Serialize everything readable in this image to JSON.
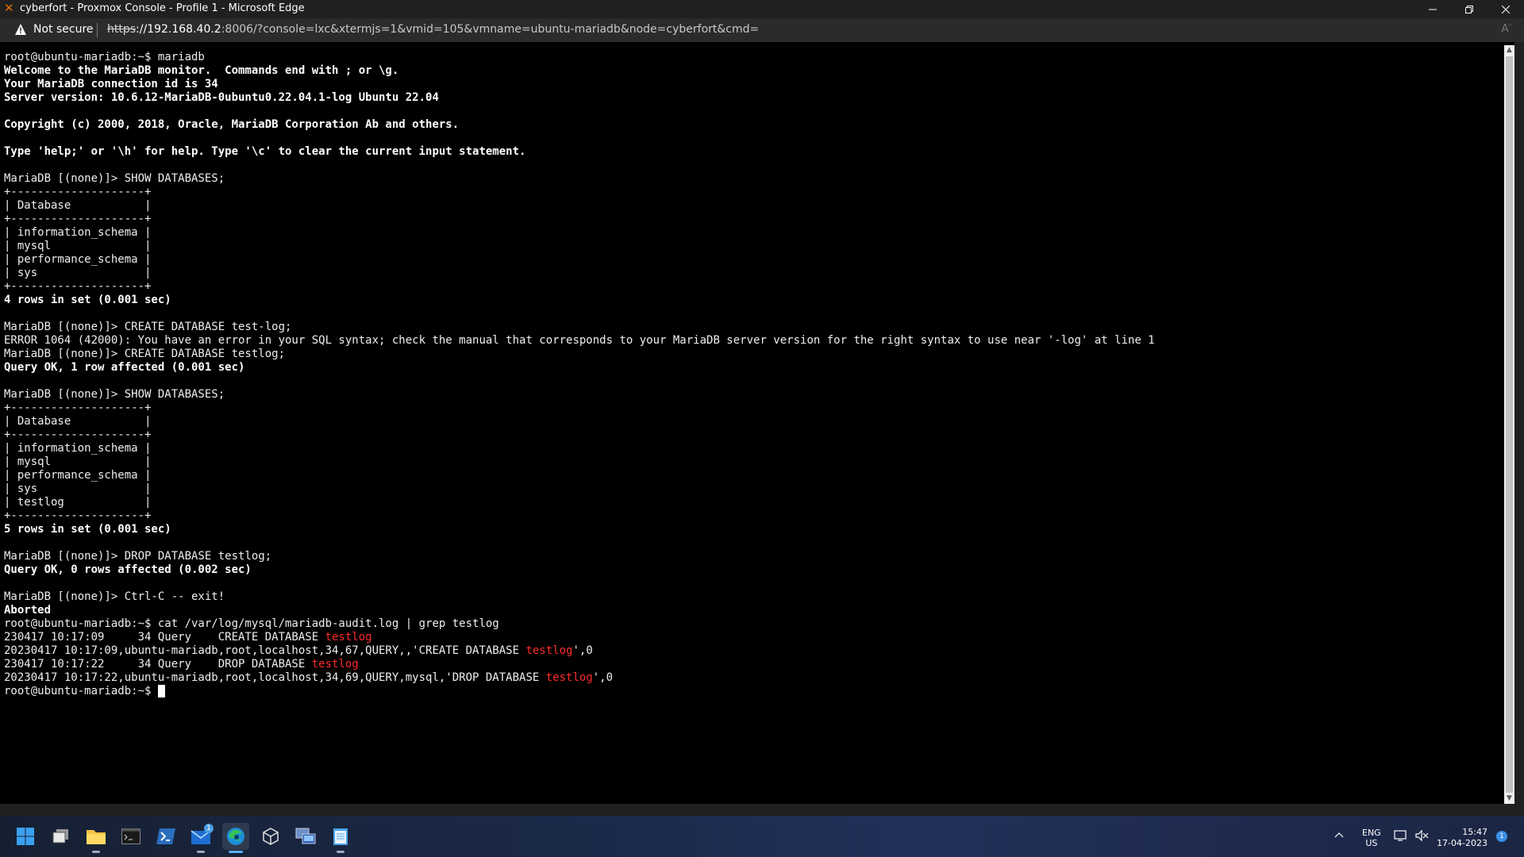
{
  "window": {
    "title": "cyberfort - Proxmox Console - Profile 1 - Microsoft Edge"
  },
  "addressbar": {
    "security_label": "Not secure",
    "url_scheme": "https",
    "url_host": "://192.168.40.2",
    "url_rest": ":8006/?console=lxc&xtermjs=1&vmid=105&vmname=ubuntu-mariadb&node=cyberfort&cmd="
  },
  "terminal": {
    "lines": [
      [
        {
          "t": "root@ubuntu-mariadb:~$ mariadb"
        }
      ],
      [
        {
          "t": "Welcome to the MariaDB monitor.  Commands end with ; or \\g.",
          "s": "b"
        }
      ],
      [
        {
          "t": "Your MariaDB connection id is 34",
          "s": "b"
        }
      ],
      [
        {
          "t": "Server version: 10.6.12-MariaDB-0ubuntu0.22.04.1-log Ubuntu 22.04",
          "s": "b"
        }
      ],
      [
        {
          "t": ""
        }
      ],
      [
        {
          "t": "Copyright (c) 2000, 2018, Oracle, MariaDB Corporation Ab and others.",
          "s": "b"
        }
      ],
      [
        {
          "t": ""
        }
      ],
      [
        {
          "t": "Type 'help;' or '\\h' for help. Type '\\c' to clear the current input statement.",
          "s": "b"
        }
      ],
      [
        {
          "t": ""
        }
      ],
      [
        {
          "t": "MariaDB [(none)]> SHOW DATABASES;"
        }
      ],
      [
        {
          "t": "+--------------------+"
        }
      ],
      [
        {
          "t": "| Database           |"
        }
      ],
      [
        {
          "t": "+--------------------+"
        }
      ],
      [
        {
          "t": "| information_schema |"
        }
      ],
      [
        {
          "t": "| mysql              |"
        }
      ],
      [
        {
          "t": "| performance_schema |"
        }
      ],
      [
        {
          "t": "| sys                |"
        }
      ],
      [
        {
          "t": "+--------------------+"
        }
      ],
      [
        {
          "t": "4 rows in set (0.001 sec)",
          "s": "b"
        }
      ],
      [
        {
          "t": ""
        }
      ],
      [
        {
          "t": "MariaDB [(none)]> CREATE DATABASE test-log;"
        }
      ],
      [
        {
          "t": "ERROR 1064 (42000): You have an error in your SQL syntax; check the manual that corresponds to your MariaDB server version for the right syntax to use near '-log' at line 1"
        }
      ],
      [
        {
          "t": "MariaDB [(none)]> CREATE DATABASE testlog;"
        }
      ],
      [
        {
          "t": "Query OK, 1 row affected (0.001 sec)",
          "s": "b"
        }
      ],
      [
        {
          "t": ""
        }
      ],
      [
        {
          "t": "MariaDB [(none)]> SHOW DATABASES;"
        }
      ],
      [
        {
          "t": "+--------------------+"
        }
      ],
      [
        {
          "t": "| Database           |"
        }
      ],
      [
        {
          "t": "+--------------------+"
        }
      ],
      [
        {
          "t": "| information_schema |"
        }
      ],
      [
        {
          "t": "| mysql              |"
        }
      ],
      [
        {
          "t": "| performance_schema |"
        }
      ],
      [
        {
          "t": "| sys                |"
        }
      ],
      [
        {
          "t": "| testlog            |"
        }
      ],
      [
        {
          "t": "+--------------------+"
        }
      ],
      [
        {
          "t": "5 rows in set (0.001 sec)",
          "s": "b"
        }
      ],
      [
        {
          "t": ""
        }
      ],
      [
        {
          "t": "MariaDB [(none)]> DROP DATABASE testlog;"
        }
      ],
      [
        {
          "t": "Query OK, 0 rows affected (0.002 sec)",
          "s": "b"
        }
      ],
      [
        {
          "t": ""
        }
      ],
      [
        {
          "t": "MariaDB [(none)]> Ctrl-C -- exit!"
        }
      ],
      [
        {
          "t": "Aborted",
          "s": "b"
        }
      ],
      [
        {
          "t": "root@ubuntu-mariadb:~$ cat /var/log/mysql/mariadb-audit.log | grep testlog"
        }
      ],
      [
        {
          "t": "230417 10:17:09     34 Query    CREATE DATABASE "
        },
        {
          "t": "testlog",
          "s": "hl"
        }
      ],
      [
        {
          "t": "20230417 10:17:09,ubuntu-mariadb,root,localhost,34,67,QUERY,,'CREATE DATABASE "
        },
        {
          "t": "testlog",
          "s": "hl"
        },
        {
          "t": "',0"
        }
      ],
      [
        {
          "t": "230417 10:17:22     34 Query    DROP DATABASE "
        },
        {
          "t": "testlog",
          "s": "hl"
        }
      ],
      [
        {
          "t": "20230417 10:17:22,ubuntu-mariadb,root,localhost,34,69,QUERY,mysql,'DROP DATABASE "
        },
        {
          "t": "testlog",
          "s": "hl"
        },
        {
          "t": "',0"
        }
      ],
      [
        {
          "t": "root@ubuntu-mariadb:~$ "
        },
        {
          "t": "",
          "s": "cursor"
        }
      ]
    ]
  },
  "taskbar": {
    "apps": [
      {
        "name": "start-button",
        "icon": "windows-logo-icon"
      },
      {
        "name": "task-view-button",
        "icon": "task-view-icon"
      },
      {
        "name": "file-explorer-button",
        "icon": "folder-icon"
      },
      {
        "name": "terminal-button",
        "icon": "terminal-icon"
      },
      {
        "name": "powershell-button",
        "icon": "powershell-icon"
      },
      {
        "name": "mail-button",
        "icon": "mail-icon",
        "badge": "1"
      },
      {
        "name": "edge-button",
        "icon": "edge-icon",
        "active": true
      },
      {
        "name": "3d-viewer-button",
        "icon": "cube-icon"
      },
      {
        "name": "remote-desktop-button",
        "icon": "remote-desktop-icon"
      },
      {
        "name": "notepad-button",
        "icon": "notepad-icon"
      }
    ],
    "tray": {
      "lang_line1": "ENG",
      "lang_line2": "US",
      "time": "15:47",
      "date": "17-04-2023",
      "notification_count": "1"
    }
  },
  "colors": {
    "terminal_bg": "#000000",
    "terminal_fg": "#eeeeee",
    "highlight": "#ff2b2b",
    "accent": "#e57000"
  }
}
